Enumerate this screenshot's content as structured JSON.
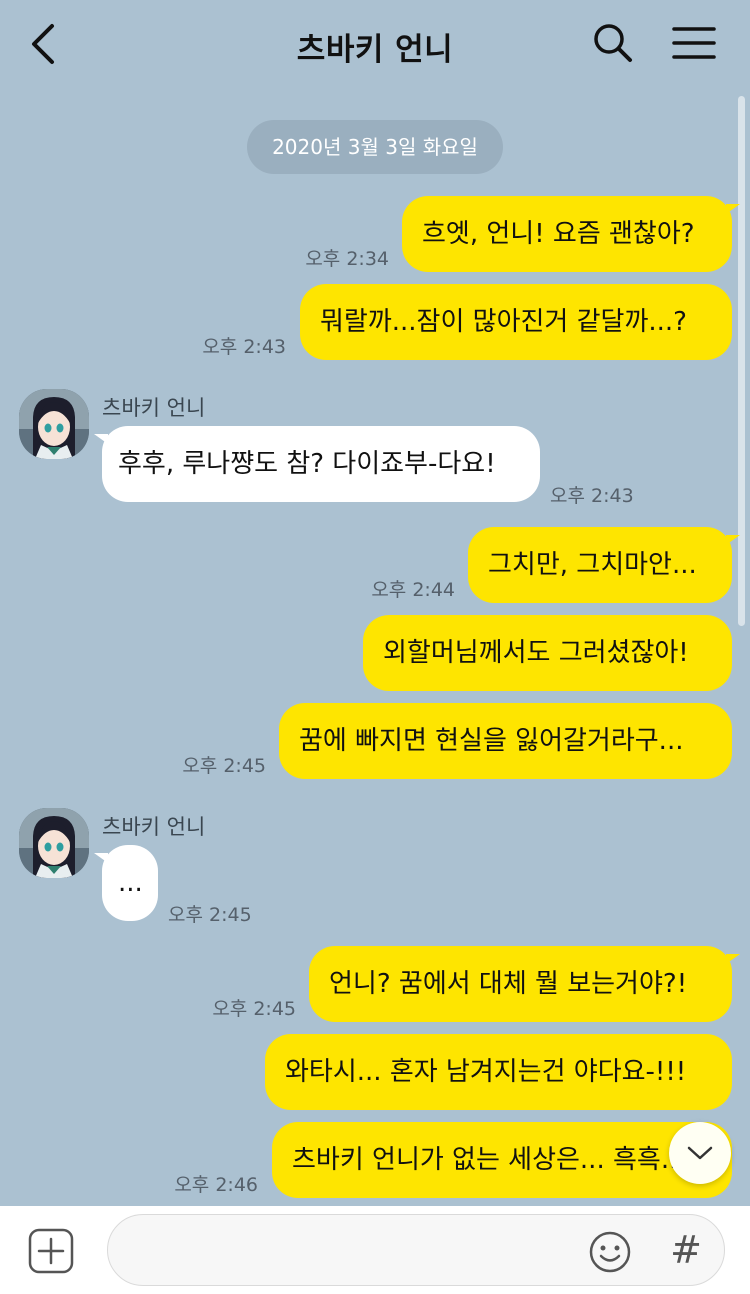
{
  "header": {
    "title": "츠바키 언니",
    "back_icon": "chevron-left-icon",
    "search_icon": "search-icon",
    "menu_icon": "hamburger-menu-icon"
  },
  "date_divider": "2020년 3월 3일 화요일",
  "messages": [
    {
      "from": "me",
      "text": "흐엣, 언니! 요즘 괜찮아?",
      "time": "오후 2:34"
    },
    {
      "from": "me",
      "text": "뭐랄까...잠이 많아진거 같달까...?",
      "time": "오후 2:43"
    },
    {
      "from": "them",
      "sender": "츠바키 언니",
      "text": "후후, 루나쨩도 참? 다이죠부-다요!",
      "time": "오후 2:43"
    },
    {
      "from": "me",
      "text": "그치만, 그치마안...",
      "time": "오후 2:44"
    },
    {
      "from": "me",
      "text": "외할머님께서도 그러셨잖아!",
      "time": ""
    },
    {
      "from": "me",
      "text": "꿈에 빠지면 현실을 잃어갈거라구...",
      "time": "오후 2:45"
    },
    {
      "from": "them",
      "sender": "츠바키 언니",
      "text": "...",
      "time": "오후 2:45"
    },
    {
      "from": "me",
      "text": "언니? 꿈에서 대체 뭘 보는거야?!",
      "time": "오후 2:45"
    },
    {
      "from": "me",
      "text": "와타시... 혼자 남겨지는건 야다요-!!!",
      "time": ""
    },
    {
      "from": "me",
      "text": "츠바키 언니가 없는 세상은... 흑흑...",
      "time": "오후 2:46"
    }
  ],
  "input": {
    "placeholder": "",
    "value": "",
    "plus_icon": "plus-square-icon",
    "emoji_icon": "smiley-icon",
    "hash_label": "#"
  },
  "colors": {
    "background": "#abc1d1",
    "my_bubble": "#fee500",
    "their_bubble": "#ffffff"
  }
}
